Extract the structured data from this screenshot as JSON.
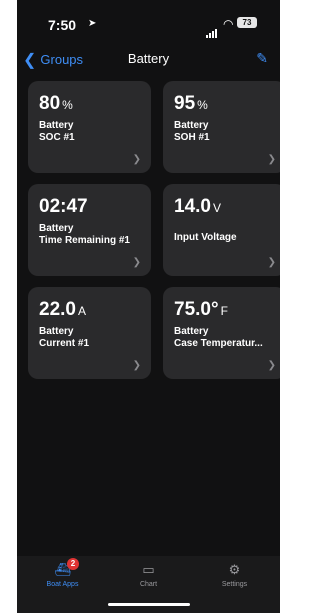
{
  "status_bar": {
    "time": "7:50",
    "battery": "73"
  },
  "nav": {
    "back_label": "Groups",
    "title": "Battery"
  },
  "cards": [
    {
      "value": "80",
      "unit": "%",
      "label1": "Battery",
      "label2": "SOC #1"
    },
    {
      "value": "95",
      "unit": "%",
      "label1": "Battery",
      "label2": "SOH #1"
    },
    {
      "value": "02:47",
      "unit": "",
      "label1": "Battery",
      "label2": "Time Remaining #1"
    },
    {
      "value": "14.0",
      "unit": "V",
      "label1": "Input Voltage",
      "label2": ""
    },
    {
      "value": "22.0",
      "unit": "A",
      "label1": "Battery",
      "label2": "Current #1"
    },
    {
      "value": "75.0°",
      "unit": "F",
      "label1": "Battery",
      "label2": "Case Temperatur..."
    }
  ],
  "tabs": [
    {
      "label": "Boat Apps",
      "badge": "2"
    },
    {
      "label": "Chart"
    },
    {
      "label": "Settings"
    }
  ],
  "colors": {
    "accent": "#3f8ef5",
    "background": "#111112",
    "card": "#2a2a2c",
    "badge": "#e03434"
  }
}
